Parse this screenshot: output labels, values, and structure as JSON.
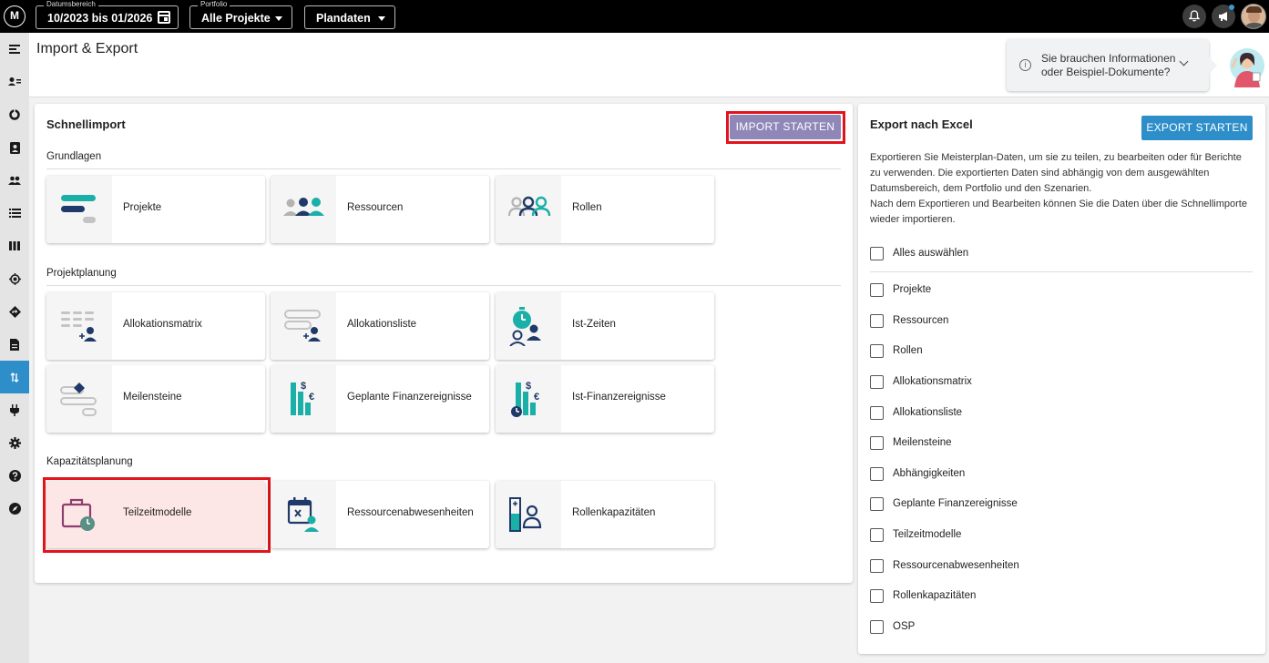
{
  "topbar": {
    "logo_text": "M",
    "date_range": {
      "label": "Datumsbereich",
      "value": "10/2023 bis 01/2026"
    },
    "portfolio": {
      "label": "Portfolio",
      "value": "Alle Projekte"
    },
    "scenario": {
      "value": "Plandaten"
    },
    "icons": [
      "bell-icon",
      "megaphone-icon",
      "user-avatar"
    ]
  },
  "sidebar": {
    "items": [
      {
        "name": "menu-toggle",
        "icon": "menu-icon"
      },
      {
        "name": "resources",
        "icon": "person-list-icon"
      },
      {
        "name": "dashboard",
        "icon": "chart-donut-icon"
      },
      {
        "name": "contact",
        "icon": "contact-card-icon"
      },
      {
        "name": "people",
        "icon": "people-icon"
      },
      {
        "name": "list",
        "icon": "list-icon"
      },
      {
        "name": "board",
        "icon": "columns-icon"
      },
      {
        "name": "target",
        "icon": "target-icon"
      },
      {
        "name": "directions",
        "icon": "direction-sign-icon"
      },
      {
        "name": "document",
        "icon": "document-icon"
      },
      {
        "name": "import-export",
        "icon": "swap-vertical-icon",
        "active": true
      },
      {
        "name": "plugins",
        "icon": "plug-icon"
      },
      {
        "name": "settings",
        "icon": "gear-icon"
      },
      {
        "name": "help",
        "icon": "help-icon"
      },
      {
        "name": "explore",
        "icon": "compass-icon"
      }
    ]
  },
  "header": {
    "title": "Import & Export",
    "info": {
      "line1": "Sie brauchen Informationen",
      "line2": "oder Beispiel-Dokumente?"
    }
  },
  "schnellimport": {
    "title": "Schnellimport",
    "button": "IMPORT STARTEN",
    "sections": [
      {
        "label": "Grundlagen",
        "tiles": [
          "Projekte",
          "Ressourcen",
          "Rollen"
        ]
      },
      {
        "label": "Projektplanung",
        "tiles": [
          "Allokationsmatrix",
          "Allokationsliste",
          "Ist-Zeiten",
          "Meilensteine",
          "Geplante Finanzereignisse",
          "Ist-Finanzereignisse"
        ]
      },
      {
        "label": "Kapazitätsplanung",
        "tiles": [
          "Teilzeitmodelle",
          "Ressourcenabwesenheiten",
          "Rollenkapazitäten"
        ]
      }
    ],
    "selected_tile": "Teilzeitmodelle"
  },
  "export": {
    "title": "Export nach Excel",
    "button": "EXPORT STARTEN",
    "desc1": "Exportieren Sie Meisterplan-Daten, um sie zu teilen, zu bearbeiten oder für Berichte zu verwenden. Die exportierten Daten sind abhängig von dem ausgewählten Datumsbereich, dem Portfolio und den Szenarien.",
    "desc2": "Nach dem Exportieren und Bearbeiten können Sie die Daten über die Schnellimporte wieder importieren.",
    "select_all": "Alles auswählen",
    "items": [
      "Projekte",
      "Ressourcen",
      "Rollen",
      "Allokationsmatrix",
      "Allokationsliste",
      "Meilensteine",
      "Abhängigkeiten",
      "Geplante Finanzereignisse",
      "Teilzeitmodelle",
      "Ressourcenabwesenheiten",
      "Rollenkapazitäten",
      "OSP"
    ]
  },
  "colors": {
    "accent": "#2e8ec9",
    "import_button": "#8f87b8",
    "highlight": "#e1141c",
    "teal": "#1ab0a8",
    "navy": "#1f3a68"
  }
}
